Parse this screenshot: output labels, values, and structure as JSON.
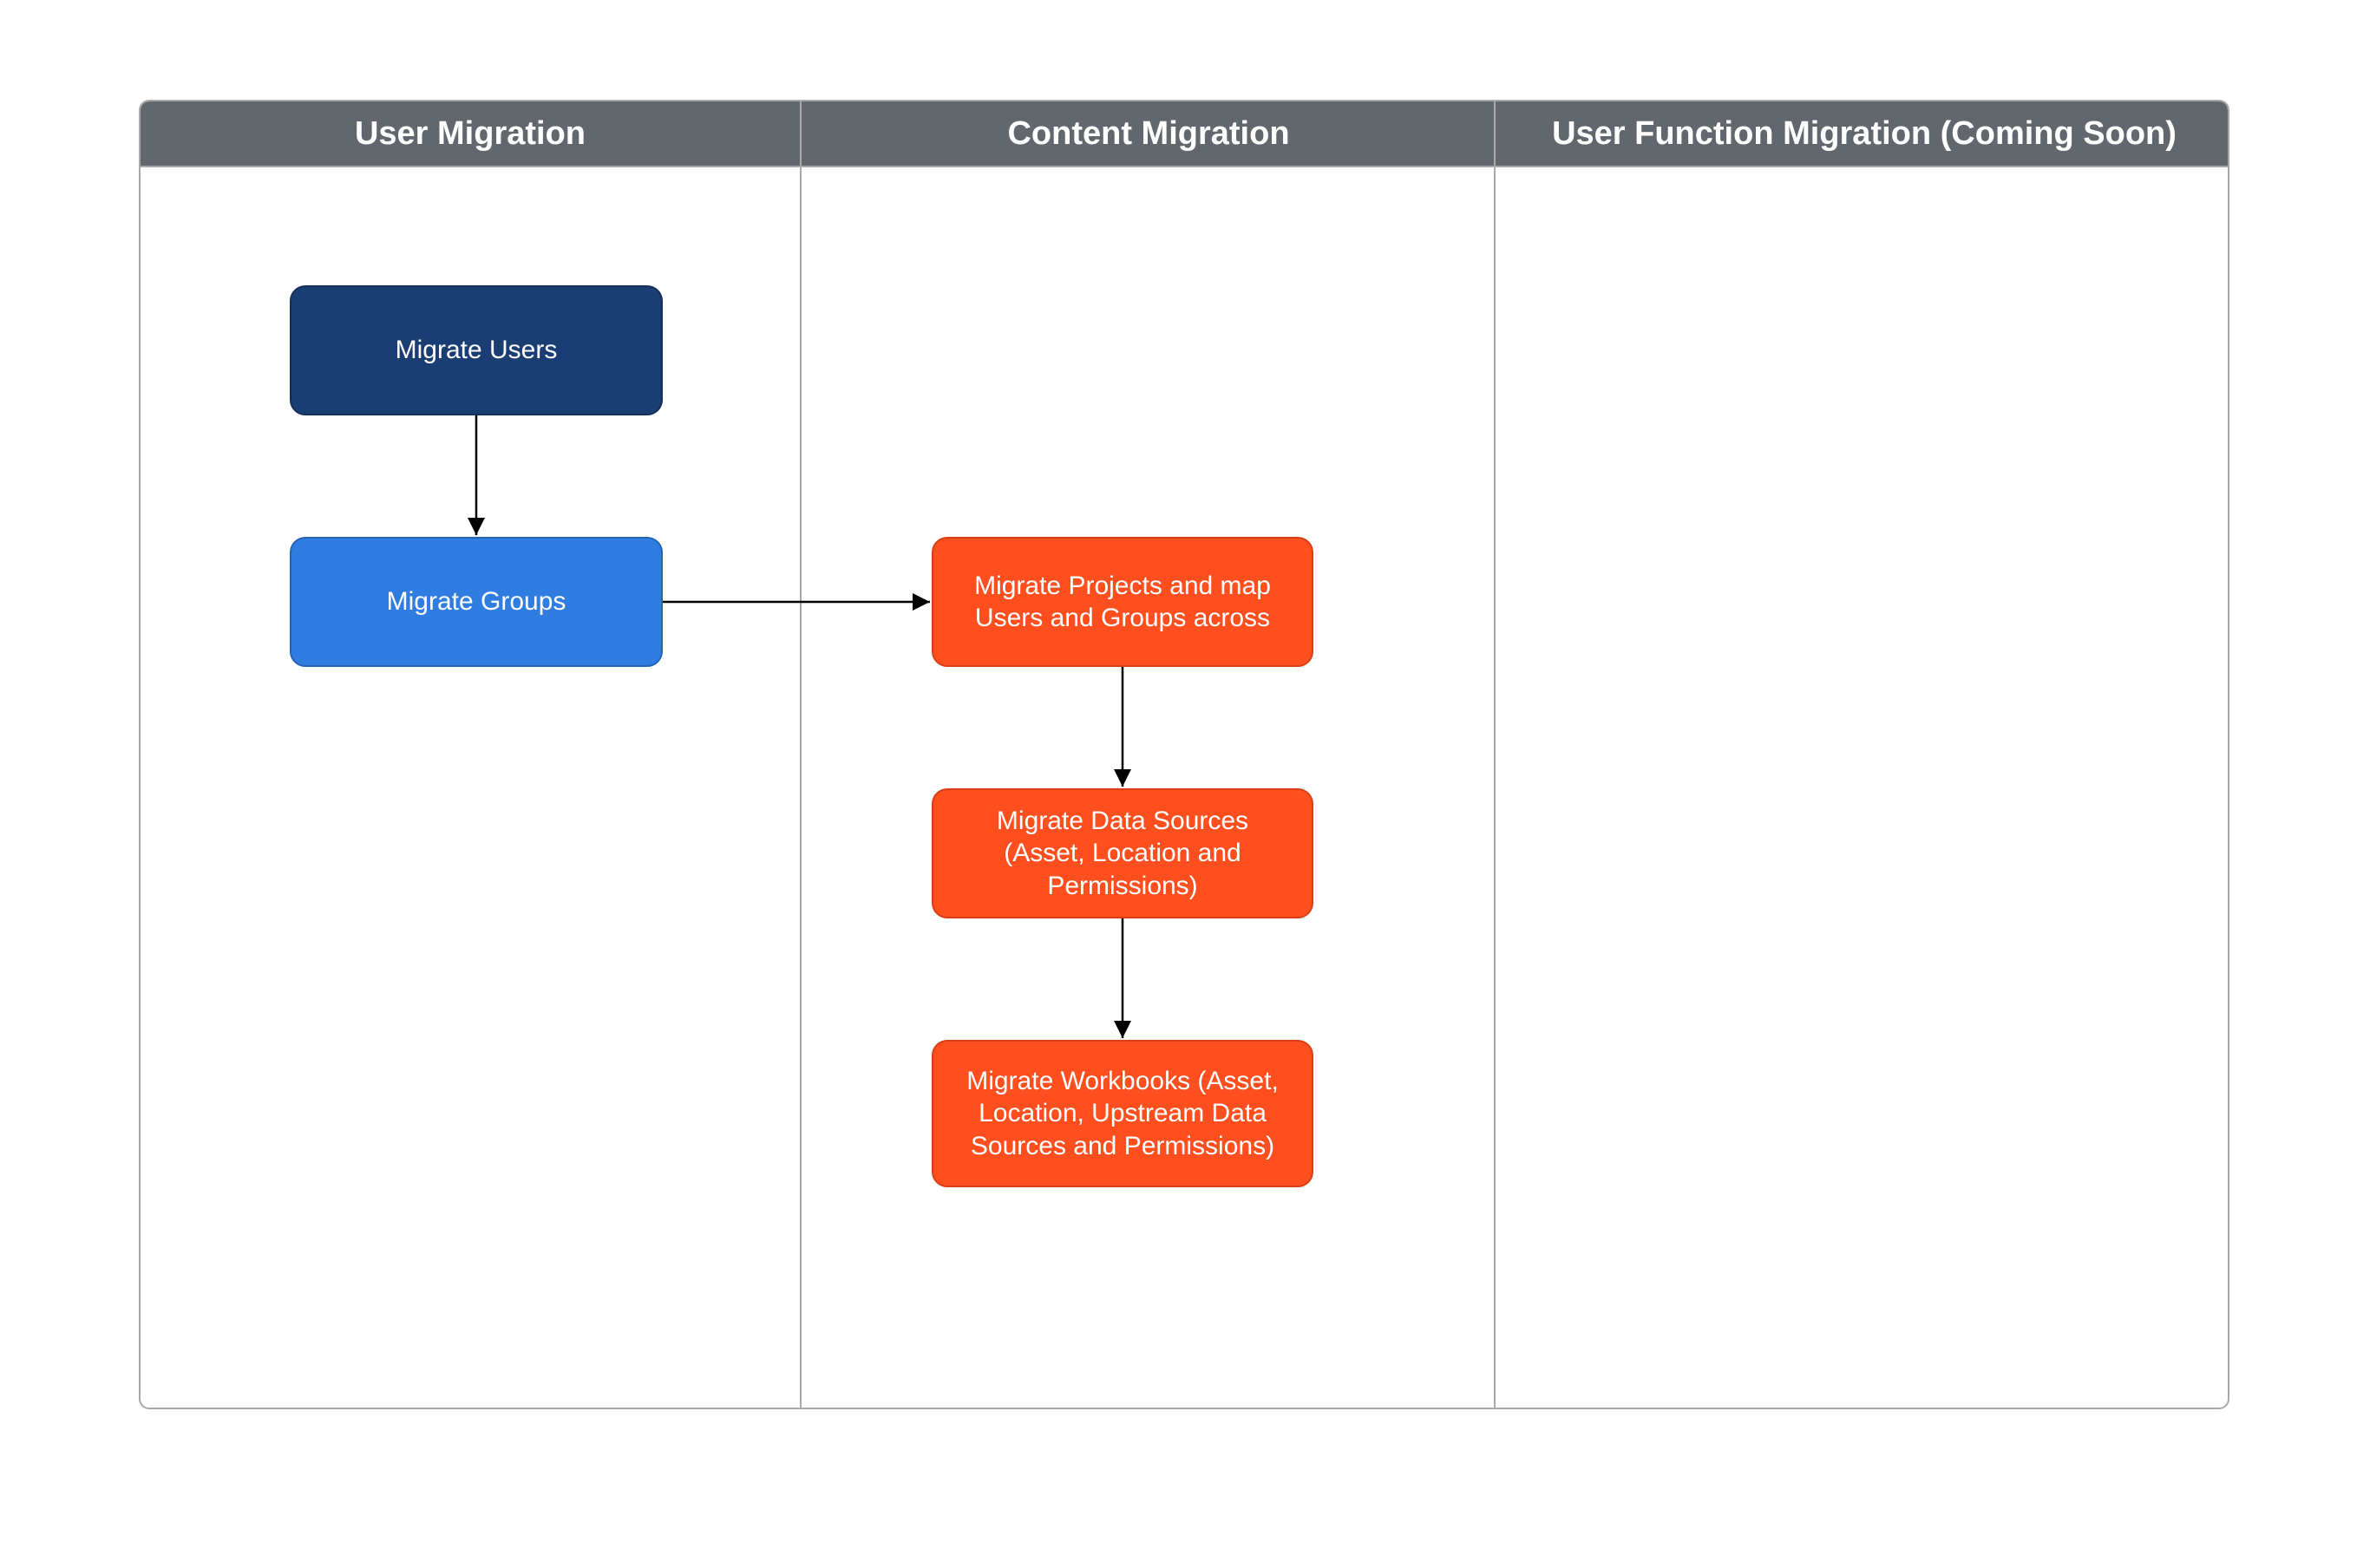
{
  "diagram": {
    "lanes": {
      "user_migration": {
        "title": "User Migration"
      },
      "content_migration": {
        "title": "Content Migration"
      },
      "user_function_migration": {
        "title": "User Function Migration (Coming Soon)"
      }
    },
    "nodes": {
      "migrate_users": {
        "label": "Migrate Users"
      },
      "migrate_groups": {
        "label": "Migrate Groups"
      },
      "migrate_projects": {
        "label": "Migrate Projects and map Users and Groups across"
      },
      "migrate_data_sources": {
        "label": "Migrate Data Sources (Asset, Location and Permissions)"
      },
      "migrate_workbooks": {
        "label": "Migrate Workbooks (Asset, Location, Upstream Data Sources and Permissions)"
      }
    },
    "flow": [
      {
        "from": "migrate_users",
        "to": "migrate_groups"
      },
      {
        "from": "migrate_groups",
        "to": "migrate_projects"
      },
      {
        "from": "migrate_projects",
        "to": "migrate_data_sources"
      },
      {
        "from": "migrate_data_sources",
        "to": "migrate_workbooks"
      }
    ],
    "colors": {
      "lane_header_bg": "#62676d",
      "border": "#a8a8a8",
      "dark_blue": "#1a3d73",
      "blue": "#2f7de1",
      "orange": "#ff4f1f"
    }
  }
}
